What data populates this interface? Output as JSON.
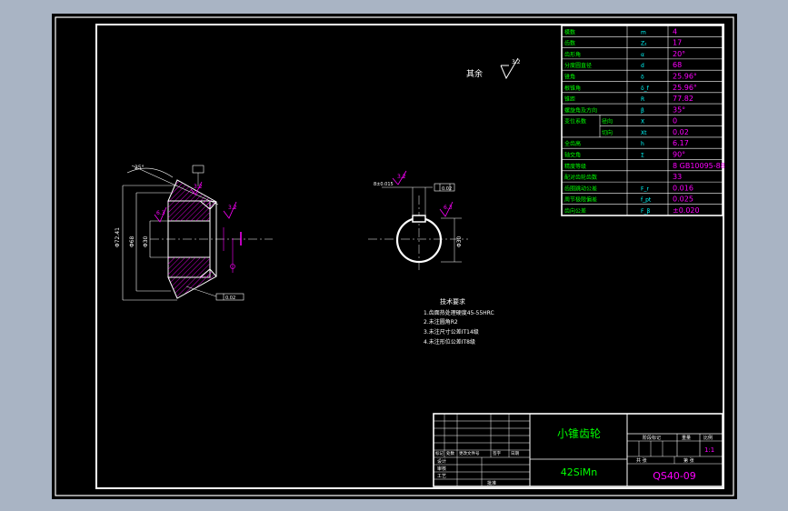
{
  "colors": {
    "viewport_bg": "#a9b4c4",
    "paper": "#000000",
    "line": "#ffffff",
    "green": "#00ff00",
    "magenta": "#ff00ff",
    "cyan": "#00ffff"
  },
  "roughness_note": {
    "label": "其余",
    "value": "3.2"
  },
  "gear_view": {
    "roughness_values": [
      "3.2",
      "3.2",
      "6.3"
    ],
    "diameter_labels": [
      "Φ72.41",
      "Φ68",
      "Φ30"
    ],
    "angle_label": "25°",
    "tolerance_label": "0.02"
  },
  "hub_view": {
    "roughness_values": [
      "3.2",
      "6.3"
    ],
    "keyway_label": "8±0.015",
    "tolerance_label": "0.02",
    "bore_label": "Φ30"
  },
  "param_table": {
    "rows": [
      {
        "name": "模数",
        "symbol": "m",
        "value": "4"
      },
      {
        "name": "齿数",
        "symbol": "Z₂",
        "value": "17"
      },
      {
        "name": "齿形角",
        "symbol": "α",
        "value": "20°"
      },
      {
        "name": "分度圆直径",
        "symbol": "d",
        "value": "68"
      },
      {
        "name": "锥角",
        "symbol": "δ",
        "value": "25.96°"
      },
      {
        "name": "根锥角",
        "symbol": "δ_f",
        "value": "25.96°"
      },
      {
        "name": "锥距",
        "symbol": "R",
        "value": "77.82"
      },
      {
        "name": "螺旋角及方向",
        "symbol": "β",
        "value": "35°"
      },
      {
        "name": "变位系数",
        "subname": "径向",
        "symbol": "X",
        "value": "0"
      },
      {
        "name": "",
        "subname": "切向",
        "symbol": "Xt",
        "value": "0.02"
      },
      {
        "name": "全齿高",
        "symbol": "h",
        "value": "6.17"
      },
      {
        "name": "轴交角",
        "symbol": "Σ",
        "value": "90°"
      },
      {
        "name": "精度等级",
        "symbol": "",
        "value": "8 GB10095-88"
      },
      {
        "name": "配对齿轮齿数",
        "symbol": "",
        "value": "33"
      },
      {
        "name": "齿圈跳动公差",
        "symbol": "F_r",
        "value": "0.016"
      },
      {
        "name": "周节极限偏差",
        "symbol": "f_pt",
        "value": "0.025"
      },
      {
        "name": "齿向公差",
        "symbol": "F_β",
        "value": "±0.020"
      }
    ]
  },
  "tech_requirements": {
    "title": "技术要求",
    "items": [
      "1.齿面热处理硬度45-55HRC",
      "2.未注圆角R2",
      "3.未注尺寸公差IT14级",
      "4.未注形位公差IT8级"
    ]
  },
  "title_block": {
    "part_name": "小锥齿轮",
    "material": "42SiMn",
    "drawing_no": "QS40-09",
    "scale": "1:1",
    "headers_left": [
      "标记",
      "处数",
      "更改文件号",
      "签字",
      "日期"
    ],
    "role_labels": [
      "设计",
      "审核",
      "工艺"
    ],
    "approve_label": "批准",
    "stage_headers": [
      "阶段标记",
      "重量",
      "比例"
    ],
    "sheet_labels": [
      "共 张",
      "第 张"
    ]
  }
}
